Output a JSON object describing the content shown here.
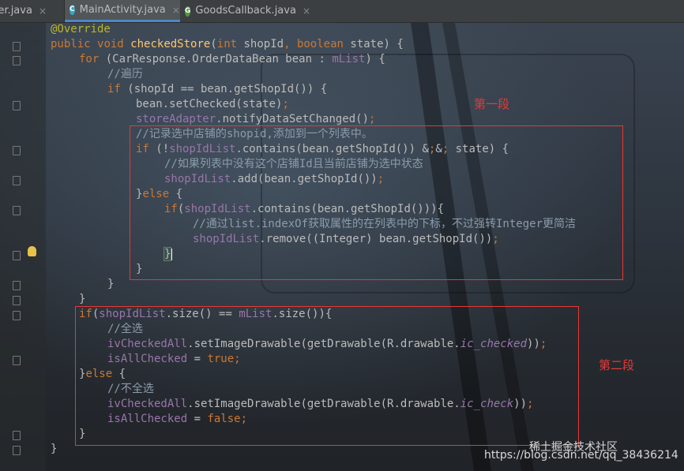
{
  "tabs": [
    {
      "label": "dapter.java",
      "icon": "java-class-icon"
    },
    {
      "label": "MainActivity.java",
      "icon": "class-c-icon"
    },
    {
      "label": "GoodsCallback.java",
      "icon": "interface-g-icon"
    }
  ],
  "code": [
    "@Override",
    "public void checkedStore(int shopId, boolean state) {",
    "for (CarResponse.OrderDataBean bean : mList) {",
    "//遍历",
    "if (shopId == bean.getShopId()) {",
    "bean.setChecked(state);",
    "storeAdapter.notifyDataSetChanged();",
    "//记录选中店铺的shopid,添加到一个列表中。",
    "if (!shopIdList.contains(bean.getShopId()) && state) {",
    "//如果列表中没有这个店铺Id且当前店铺为选中状态",
    "shopIdList.add(bean.getShopId());",
    "}else {",
    "if(shopIdList.contains(bean.getShopId())){",
    "//通过list.indexOf获取属性的在列表中的下标，不过强转Integer更简洁",
    "shopIdList.remove((Integer) bean.getShopId());",
    "}",
    "}",
    "}",
    "}",
    "if(shopIdList.size() == mList.size()){",
    "//全选",
    "ivCheckedAll.setImageDrawable(getDrawable(R.drawable.ic_checked));",
    "isAllChecked = true;",
    "}else {",
    "//不全选",
    "ivCheckedAll.setImageDrawable(getDrawable(R.drawable.ic_check));",
    "isAllChecked = false;",
    "}",
    "}"
  ],
  "annotations": {
    "section1": "第一段",
    "section2": "第二段"
  },
  "watermark": {
    "logo_text": "稀土掘金技术社区",
    "url": "https://blog.csdn.net/qq_38436214"
  },
  "colors": {
    "keyword": "#cc7832",
    "annotation": "#bbb529",
    "method": "#ffc66d",
    "field": "#9876aa",
    "comment": "#8b9cab",
    "highlight_box": "#e53935"
  }
}
